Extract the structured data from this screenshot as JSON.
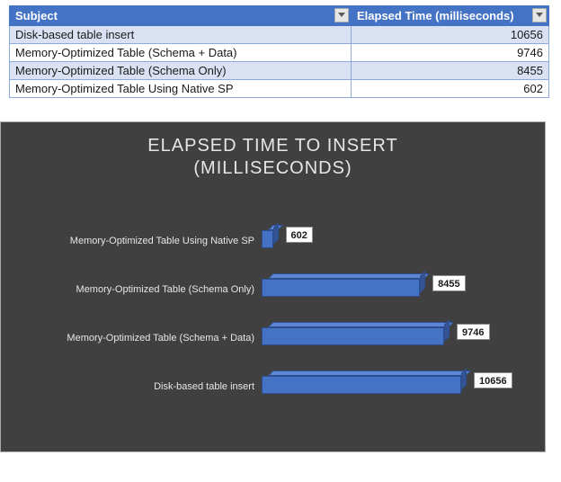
{
  "table": {
    "headers": {
      "subject": "Subject",
      "value": "Elapsed Time (milliseconds)"
    },
    "rows": [
      {
        "subject": "Disk-based table insert",
        "value": 10656,
        "band": "a"
      },
      {
        "subject": "Memory-Optimized Table (Schema + Data)",
        "value": 9746,
        "band": "b"
      },
      {
        "subject": "Memory-Optimized Table (Schema Only)",
        "value": 8455,
        "band": "a"
      },
      {
        "subject": "Memory-Optimized Table Using Native SP",
        "value": 602,
        "band": "b"
      }
    ]
  },
  "chart_data": {
    "type": "bar",
    "orientation": "horizontal",
    "title": "ELAPSED TIME TO INSERT (MILLISECONDS)",
    "title_line1": "ELAPSED TIME TO INSERT",
    "title_line2": "(MILLISECONDS)",
    "categories": [
      "Memory-Optimized Table Using Native SP",
      "Memory-Optimized Table (Schema Only)",
      "Memory-Optimized Table (Schema + Data)",
      "Disk-based table insert"
    ],
    "values": [
      602,
      8455,
      9746,
      10656
    ],
    "xlim": [
      0,
      12000
    ],
    "xlabel": "",
    "ylabel": "",
    "data_labels_visible": true,
    "style": "3d",
    "bar_color": "#4472C4",
    "background": "#404040",
    "text_color": "#E6E6E6"
  }
}
